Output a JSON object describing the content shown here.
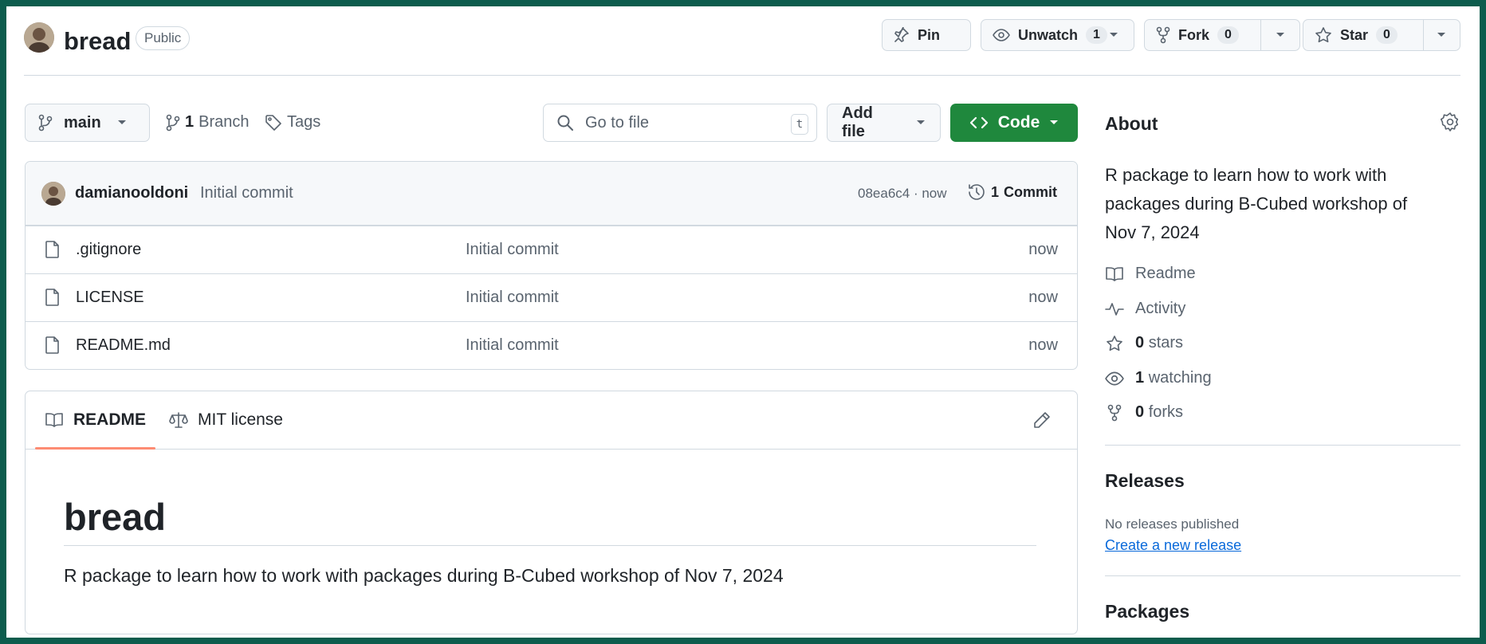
{
  "header": {
    "repo_name": "bread",
    "visibility": "Public",
    "pin_label": "Pin",
    "watch_label": "Unwatch",
    "watch_count": "1",
    "fork_label": "Fork",
    "fork_count": "0",
    "star_label": "Star",
    "star_count": "0"
  },
  "toolbar": {
    "branch": "main",
    "branches_count": "1",
    "branches_label": "Branch",
    "tags_label": "Tags",
    "search_placeholder": "Go to file",
    "search_shortcut": "t",
    "add_file_label": "Add file",
    "code_label": "Code"
  },
  "latest_commit": {
    "author": "damianooldoni",
    "message": "Initial commit",
    "hash_time": "08ea6c4 · now",
    "commits_count": "1",
    "commits_label": "Commit"
  },
  "files": [
    {
      "name": ".gitignore",
      "message": "Initial commit",
      "time": "now"
    },
    {
      "name": "LICENSE",
      "message": "Initial commit",
      "time": "now"
    },
    {
      "name": "README.md",
      "message": "Initial commit",
      "time": "now"
    }
  ],
  "readme": {
    "tab_readme": "README",
    "tab_license": "MIT license",
    "title": "bread",
    "body": "R package to learn how to work with packages during B-Cubed workshop of Nov 7, 2024"
  },
  "sidebar": {
    "about_title": "About",
    "description": "R package to learn how to work with packages during B-Cubed workshop of Nov 7, 2024",
    "readme_label": "Readme",
    "activity_label": "Activity",
    "stars_count": "0",
    "stars_label": "stars",
    "watching_count": "1",
    "watching_label": "watching",
    "forks_count": "0",
    "forks_label": "forks",
    "releases_title": "Releases",
    "no_releases": "No releases published",
    "create_release": "Create a new release",
    "packages_title": "Packages"
  },
  "colors": {
    "accent_green": "#1f883d",
    "link_blue": "#0969da",
    "tab_underline": "#fd8c73",
    "frame": "#0d5c4d"
  },
  "icons": [
    "repo-avatar",
    "pin-icon",
    "eye-icon",
    "fork-icon",
    "star-icon",
    "branch-icon",
    "tag-icon",
    "search-icon",
    "code-icon",
    "history-icon",
    "file-icon",
    "book-icon",
    "law-icon",
    "pencil-icon",
    "gear-icon",
    "pulse-icon"
  ]
}
